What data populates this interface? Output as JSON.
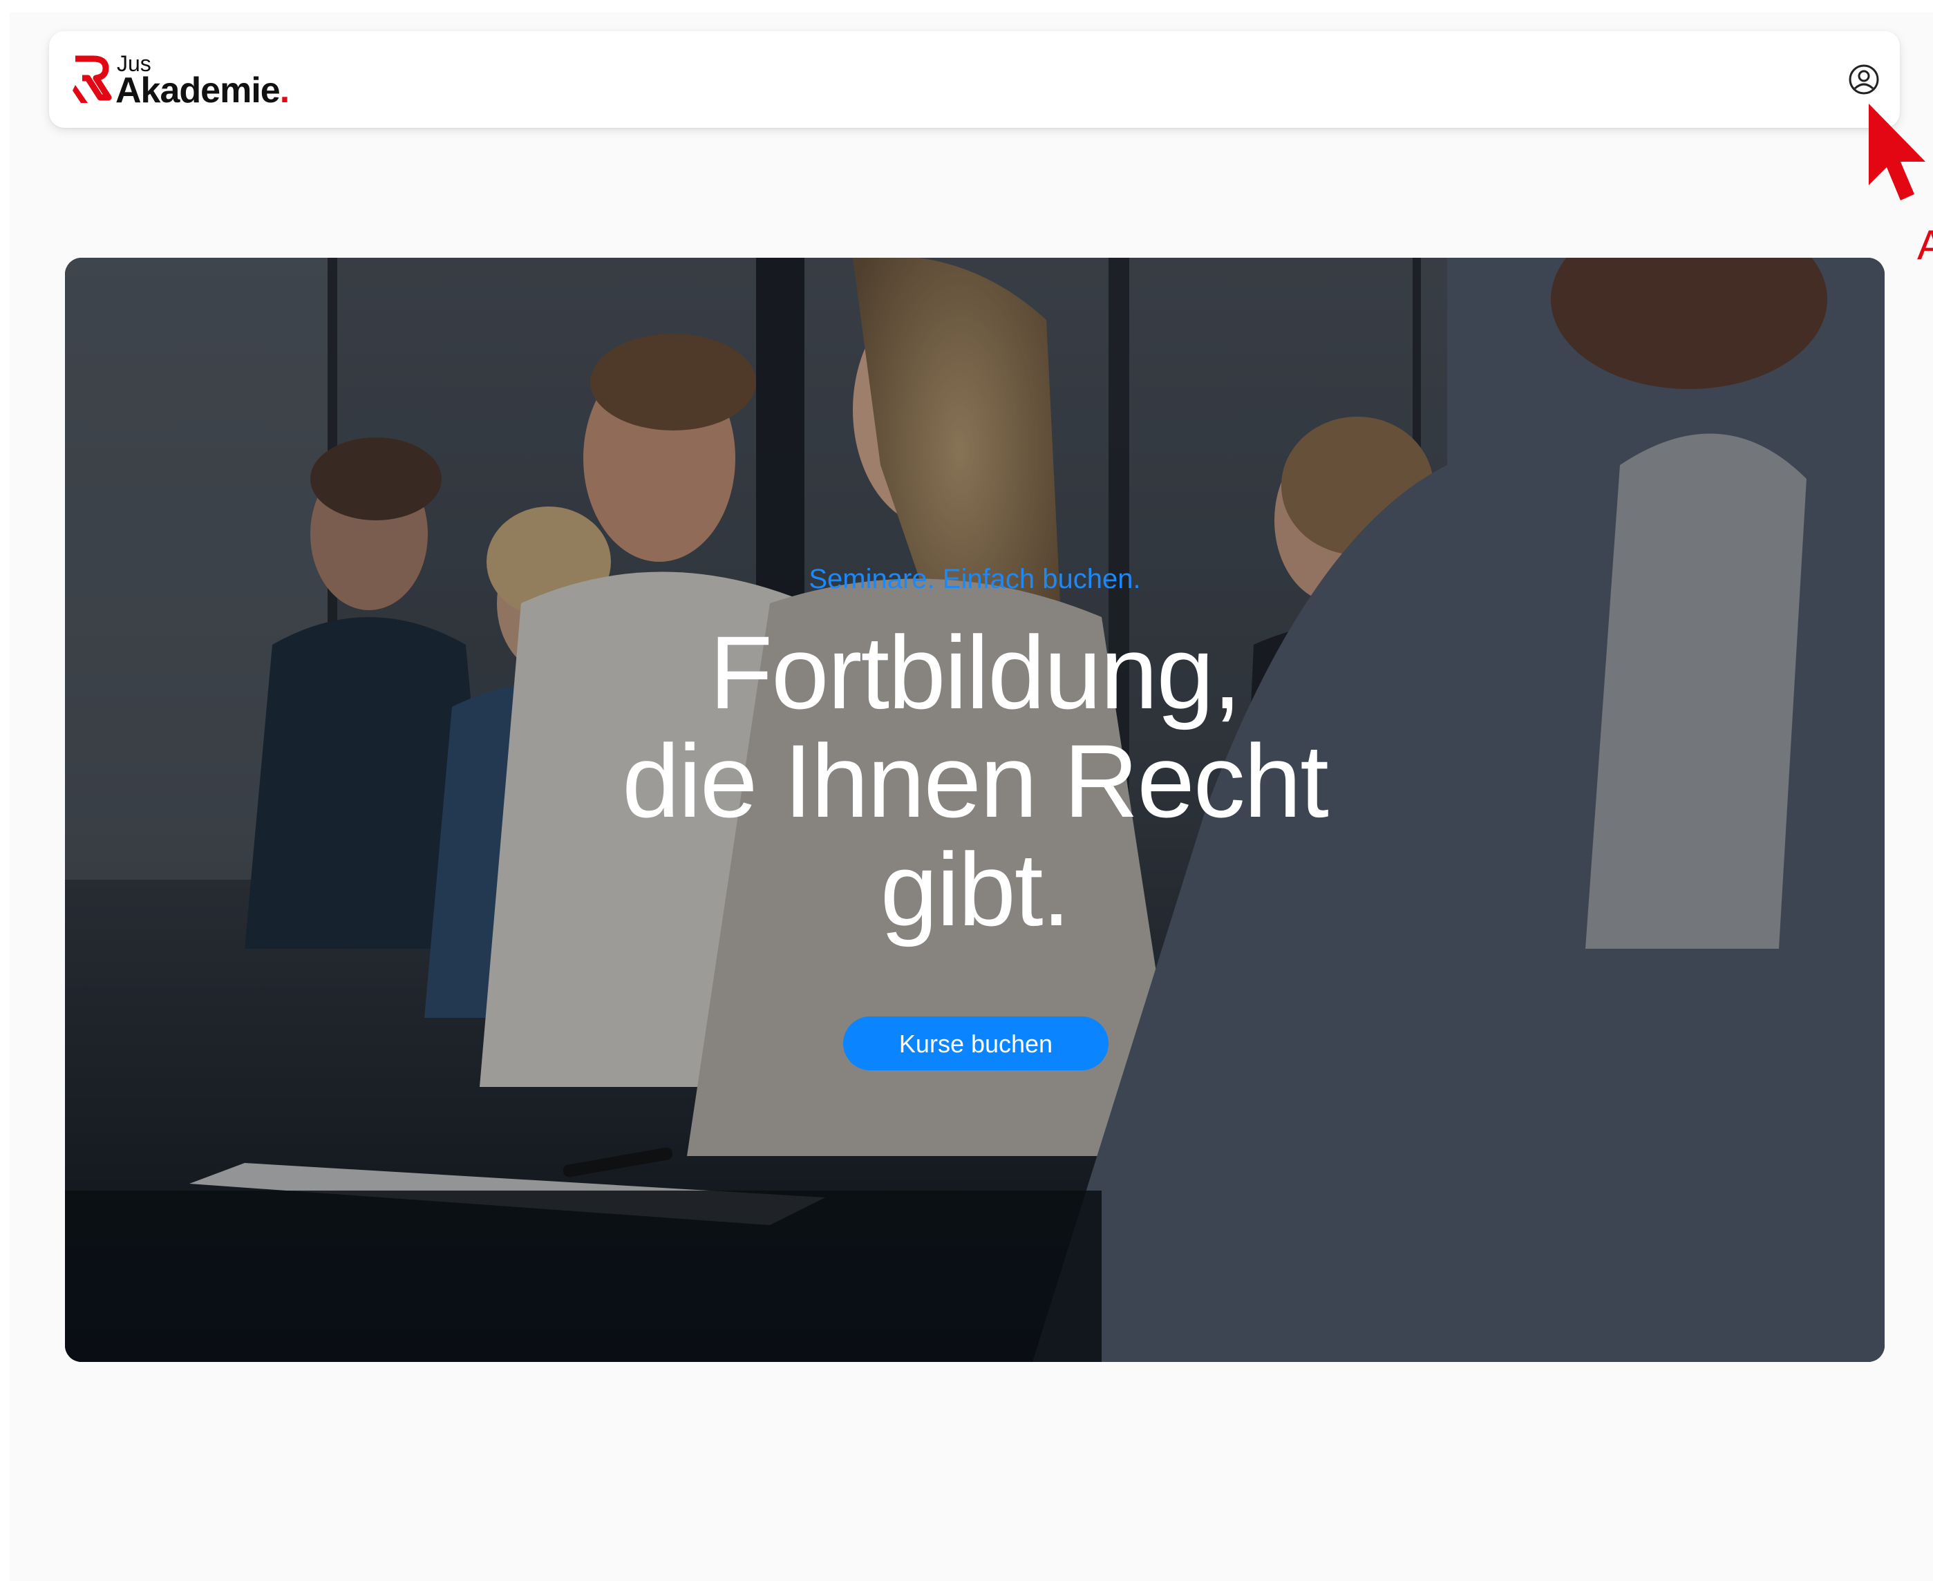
{
  "header": {
    "logo_small": "Jus",
    "logo_large": "Akademie",
    "logo_dot": ".",
    "account_icon": "user-circle-icon"
  },
  "cursor": {
    "icon": "pointer-cursor-icon",
    "label": "A",
    "color": "#e30613"
  },
  "hero": {
    "eyebrow": "Seminare. Einfach buchen.",
    "headline_line1": "Fortbildung,",
    "headline_line2": "die Ihnen Recht",
    "headline_line3": "gibt.",
    "cta_label": "Kurse buchen",
    "accent_color": "#0a84ff"
  },
  "colors": {
    "brand_red": "#e30613",
    "page_background": "#fafafa",
    "button_blue": "#0a84ff"
  }
}
